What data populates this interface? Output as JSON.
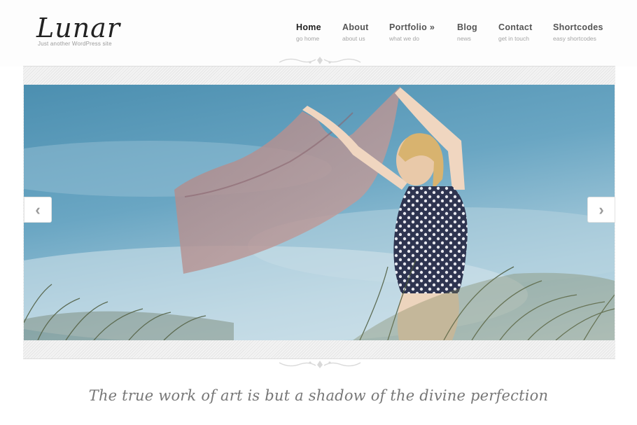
{
  "site": {
    "logo": "Lunar",
    "tagline": "Just another WordPress site"
  },
  "nav": {
    "items": [
      {
        "label": "Home",
        "sub": "go home"
      },
      {
        "label": "About",
        "sub": "about us"
      },
      {
        "label": "Portfolio »",
        "sub": "what we do"
      },
      {
        "label": "Blog",
        "sub": "news"
      },
      {
        "label": "Contact",
        "sub": "get in touch"
      },
      {
        "label": "Shortcodes",
        "sub": "easy shortcodes"
      }
    ],
    "active": "Home"
  },
  "slider": {
    "prev_icon": "chevron-left-icon",
    "next_icon": "chevron-right-icon",
    "prev_glyph": "‹",
    "next_glyph": "›"
  },
  "quote": {
    "text": "The true work of art is but a shadow of the divine perfection"
  },
  "colors": {
    "background": "#ffffff",
    "text": "#555555",
    "quote": "#777777",
    "sky": "#5e9bb9"
  }
}
